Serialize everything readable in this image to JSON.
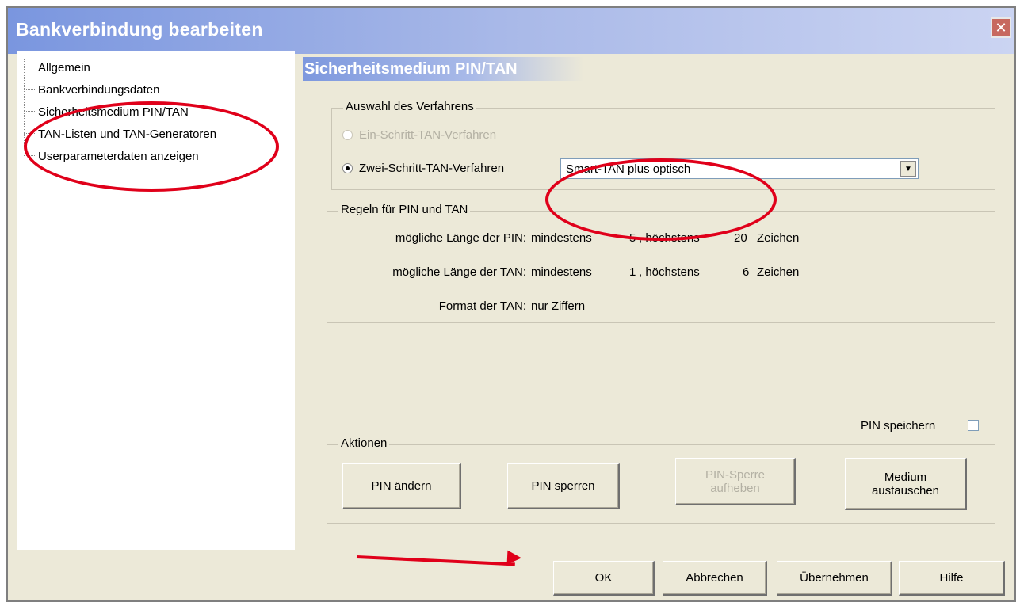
{
  "window": {
    "title": "Bankverbindung bearbeiten",
    "close_glyph": "✕"
  },
  "tree": {
    "items": [
      {
        "label": "Allgemein"
      },
      {
        "label": "Bankverbindungsdaten"
      },
      {
        "label": "Sicherheitsmedium PIN/TAN"
      },
      {
        "label": "TAN-Listen und TAN-Generatoren"
      },
      {
        "label": "Userparameterdaten anzeigen"
      }
    ]
  },
  "panel": {
    "header": "Sicherheitsmedium PIN/TAN"
  },
  "verfahren": {
    "legend": "Auswahl des Verfahrens",
    "option1": "Ein-Schritt-TAN-Verfahren",
    "option2": "Zwei-Schritt-TAN-Verfahren",
    "selected_value": "Smart-TAN plus optisch"
  },
  "regeln": {
    "legend": "Regeln für PIN und TAN",
    "pin_label": "mögliche Länge der PIN:",
    "pin_min_text": "mindestens",
    "pin_min": "5",
    "pin_max_text": ", höchstens",
    "pin_max": "20",
    "pin_unit": "Zeichen",
    "tan_label": "mögliche Länge der TAN:",
    "tan_min_text": "mindestens",
    "tan_min": "1",
    "tan_max_text": ", höchstens",
    "tan_max": "6",
    "tan_unit": "Zeichen",
    "format_label": "Format der TAN:",
    "format_value": "nur Ziffern"
  },
  "pin_speichern": {
    "label": "PIN speichern",
    "checked": false
  },
  "aktionen": {
    "legend": "Aktionen",
    "btn_pin_aendern": "PIN ändern",
    "btn_pin_sperren": "PIN sperren",
    "btn_sperre_line1": "PIN-Sperre",
    "btn_sperre_line2": "aufheben",
    "btn_medium_line1": "Medium",
    "btn_medium_line2": "austauschen"
  },
  "footer": {
    "ok": "OK",
    "abbrechen": "Abbrechen",
    "uebernehmen": "Übernehmen",
    "hilfe": "Hilfe"
  },
  "colors": {
    "annotation": "#e0001a",
    "title_gradient_start": "#7A96DF",
    "dialog_bg": "#ECE9D8"
  }
}
